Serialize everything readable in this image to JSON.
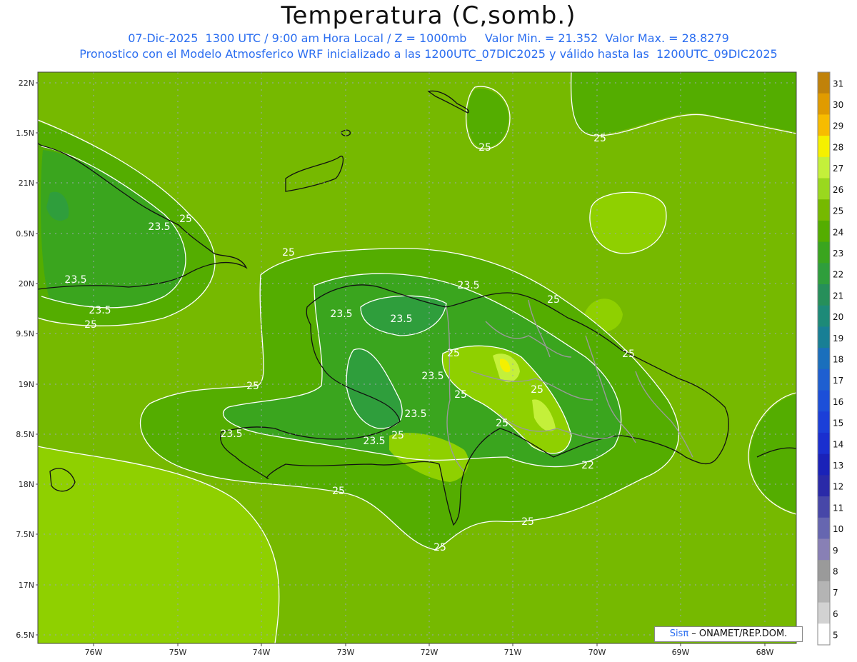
{
  "title": "Temperatura (C,somb.)",
  "subtitle_line1": "07-Dic-2025  1300 UTC / 9:00 am Hora Local / Z = 1000mb     Valor Min. = 21.352  Valor Max. = 28.8279",
  "subtitle_line2": "Pronostico con el Modelo Atmosferico WRF inicializado a las 1200UTC_07DIC2025 y válido hasta las  1200UTC_09DIC2025",
  "lat_labels": [
    "22N",
    "1.5N",
    "21N",
    "0.5N",
    "20N",
    "9.5N",
    "19N",
    "8.5N",
    "18N",
    "7.5N",
    "17N",
    "6.5N"
  ],
  "lon_labels": [
    "76W",
    "75W",
    "74W",
    "73W",
    "72W",
    "71W",
    "70W",
    "69W",
    "68W"
  ],
  "colorbar": {
    "labels": [
      "31",
      "30",
      "29",
      "28",
      "27",
      "26",
      "25",
      "24",
      "23",
      "22",
      "21",
      "20",
      "19",
      "18",
      "17",
      "16",
      "15",
      "14",
      "13",
      "12",
      "11",
      "10",
      "9",
      "8",
      "7",
      "6",
      "5"
    ],
    "colors": [
      "#c0820a",
      "#e09b00",
      "#f7bc00",
      "#f5f000",
      "#c4f03a",
      "#9ad81e",
      "#76b900",
      "#54ad00",
      "#3aa51e",
      "#2f9e3c",
      "#268f5a",
      "#1d8a78",
      "#187f95",
      "#1a6fbc",
      "#1e5fd0",
      "#1c4fd8",
      "#1b3fd8",
      "#1a2fcf",
      "#1a22b8",
      "#2a2aa8",
      "#4747a8",
      "#6666b0",
      "#8880b5",
      "#9a9a9a",
      "#b4b4b4",
      "#d2d2d2",
      "#ffffff"
    ]
  },
  "contour_labels": [
    "25",
    "25",
    "25",
    "25",
    "25",
    "25",
    "25",
    "25",
    "25",
    "25",
    "25",
    "25",
    "25",
    "25",
    "25",
    "25",
    "23.5",
    "23.5",
    "23.5",
    "23.5",
    "23.5",
    "23.5",
    "23.5",
    "23.5",
    "23.5",
    "23.5",
    "22"
  ],
  "credit": {
    "logo": "Sisπ",
    "text": " – ONAMET/REP.DOM."
  }
}
